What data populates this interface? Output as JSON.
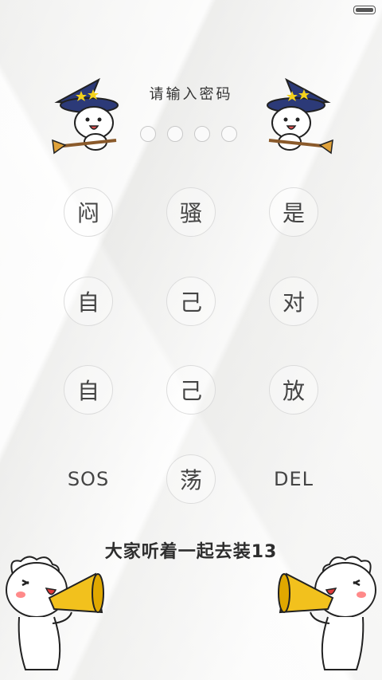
{
  "prompt": "请输入密码",
  "pin_length": 4,
  "keys": [
    "闷",
    "骚",
    "是",
    "自",
    "己",
    "对",
    "自",
    "己",
    "放",
    "SOS",
    "荡",
    "DEL"
  ],
  "slogan": "大家听着一起去装13",
  "colors": {
    "hat": "#2c3a78",
    "star": "#f4d21c",
    "megaphone": "#f2c11d",
    "cheek": "#ff8a8a"
  }
}
